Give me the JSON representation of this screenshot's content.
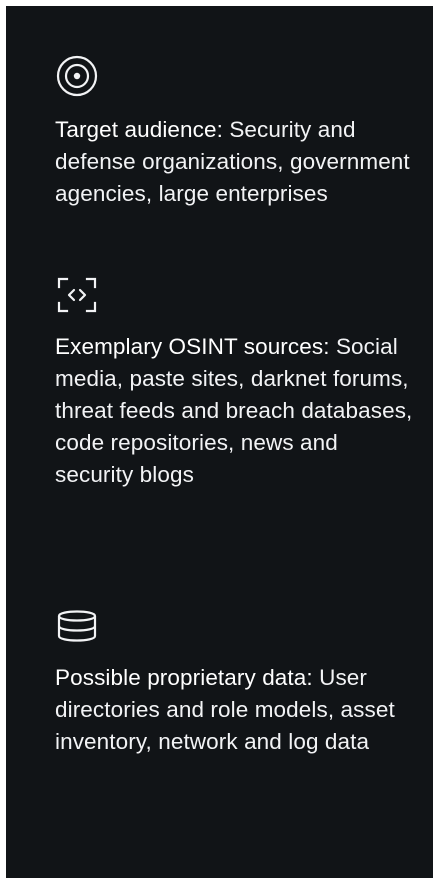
{
  "sections": [
    {
      "icon": "target-icon",
      "label": "Target audience:",
      "body": "Security and defense organizations, government agencies, large enterprises"
    },
    {
      "icon": "code-brackets-icon",
      "label": "Exemplary OSINT sources:",
      "body": "Social media, paste sites, darknet forums, threat feeds and breach databases, code repositories, news and security blogs"
    },
    {
      "icon": "database-icon",
      "label": "Possible proprietary data:",
      "body": "User directories and role models, asset inventory, network and log data"
    }
  ],
  "colors": {
    "panel_background": "#111417",
    "text": "#f2f3f5"
  }
}
